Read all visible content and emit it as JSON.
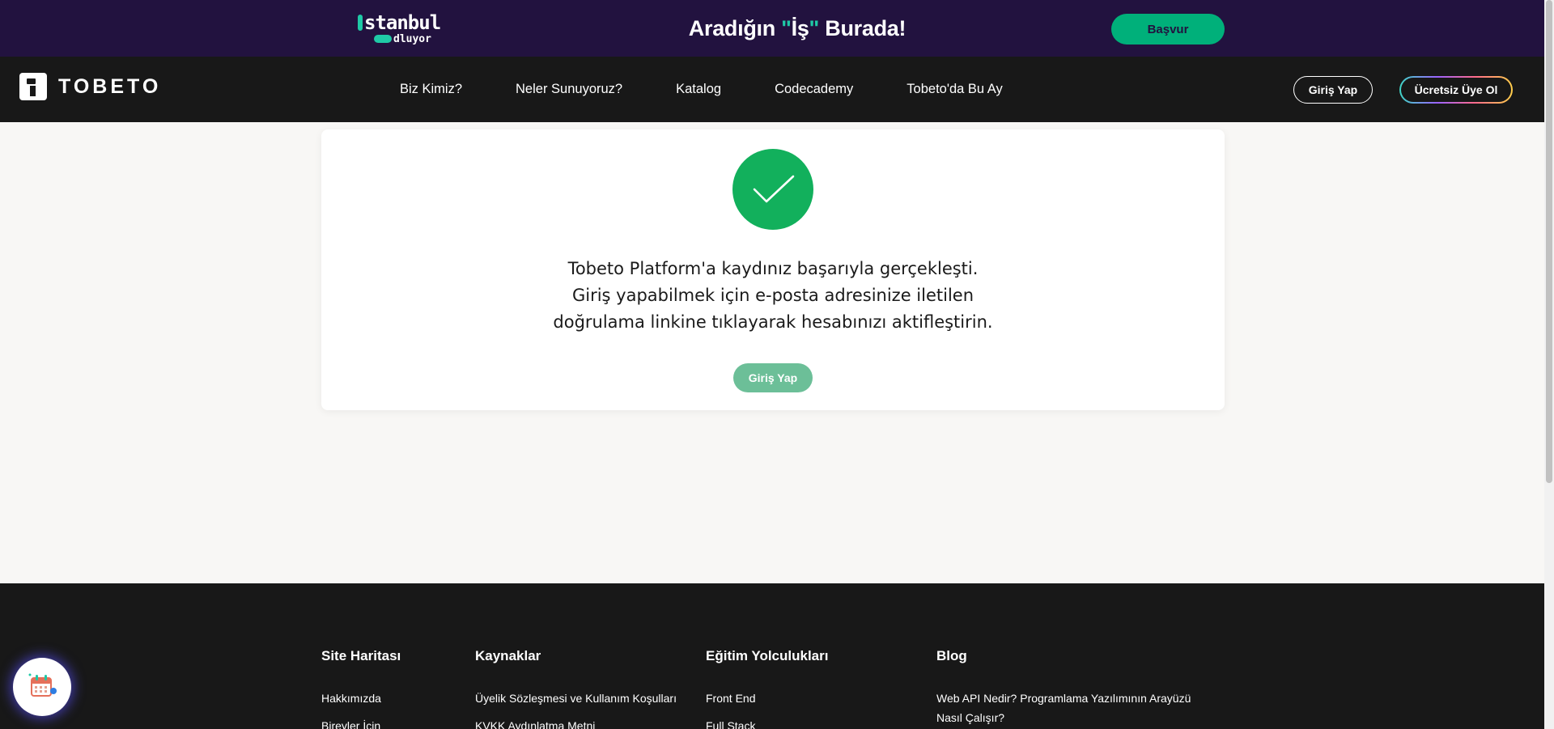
{
  "promo": {
    "logo_line1": "stanbul",
    "logo_line2": "dluyor",
    "headline_prefix": "Aradığın ",
    "headline_quote_open": "\"",
    "headline_word": "İş",
    "headline_quote_close": "\"",
    "headline_suffix": " Burada!",
    "apply_label": "Başvur"
  },
  "navbar": {
    "brand": "TOBETO",
    "links": [
      "Biz Kimiz?",
      "Neler Sunuyoruz?",
      "Katalog",
      "Codecademy",
      "Tobeto'da Bu Ay"
    ],
    "login_label": "Giriş Yap",
    "signup_label": "Ücretsiz Üye Ol"
  },
  "card": {
    "message_lines": [
      "Tobeto Platform'a kaydınız başarıyla gerçekleşti.",
      "Giriş yapabilmek için e-posta adresinize iletilen",
      "doğrulama linkine tıklayarak hesabınızı aktifleştirin."
    ],
    "login_label": "Giriş Yap",
    "success_icon": "check-icon"
  },
  "footer": {
    "columns": [
      {
        "title": "Site Haritası",
        "links": [
          "Hakkımızda",
          "Bireyler İçin"
        ]
      },
      {
        "title": "Kaynaklar",
        "links": [
          "Üyelik Sözleşmesi ve Kullanım Koşulları",
          "KVKK Aydınlatma Metni"
        ]
      },
      {
        "title": "Eğitim Yolculukları",
        "links": [
          "Front End",
          "Full Stack"
        ]
      },
      {
        "title": "Blog",
        "links": [
          "Web API Nedir? Programlama Yazılımının Arayüzü Nasıl Çalışır?"
        ]
      }
    ]
  },
  "colors": {
    "promo_bg": "#22123f",
    "accent_teal": "#1fc9a6",
    "apply_green": "#00b07a",
    "navbar_bg": "#181818",
    "success_green": "#12b05c",
    "page_bg": "#f8f7f5"
  },
  "widget": {
    "icon": "calendar-icon"
  }
}
